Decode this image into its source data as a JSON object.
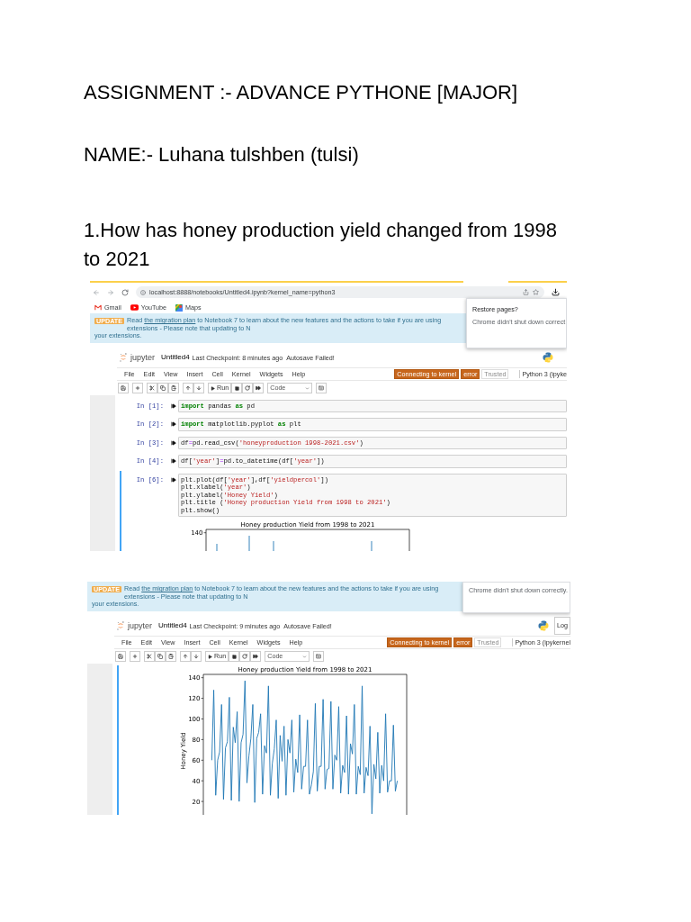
{
  "document": {
    "title": "ASSIGNMENT :- ADVANCE PYTHONE [MAJOR]",
    "student": "NAME:- Luhana tulshben (tulsi)",
    "question": "1.How has honey production yield changed from 1998 to 2021"
  },
  "screenshots": [
    {
      "browser": {
        "url": "localhost:8888/notebooks/Untitled4.ipynb?kernel_name=python3",
        "bookmarks": [
          {
            "kind": "gmail",
            "label": "Gmail"
          },
          {
            "kind": "youtube",
            "label": "YouTube"
          },
          {
            "kind": "maps",
            "label": "Maps"
          }
        ]
      },
      "popup": {
        "title": "Restore pages?",
        "message": "Chrome didn't shut down correct"
      },
      "banner": {
        "badge": "UPDATE",
        "before": "Read ",
        "link": "the migration plan",
        "after": " to Notebook 7 to learn about the new features and the actions to take if you are using extensions - Please note that updating to N",
        "second_line": "your extensions."
      },
      "header": {
        "logo": "jupyter",
        "notebook_name": "Untitled4",
        "checkpoint": "Last Checkpoint: 8 minutes ago",
        "autosave": "Autosave Failed!"
      },
      "menu": [
        "File",
        "Edit",
        "View",
        "Insert",
        "Cell",
        "Kernel",
        "Widgets",
        "Help"
      ],
      "indicators": [
        {
          "kind": "alert",
          "text": "Connecting to kernel"
        },
        {
          "kind": "alert",
          "text": "error"
        },
        {
          "kind": "plain",
          "text": "Trusted"
        }
      ],
      "kernel": "Python 3 (ipyke",
      "toolbar": {
        "run_label": "Run",
        "cell_type": "Code"
      },
      "cells": [
        {
          "prompt": "In [1]:",
          "selected": false,
          "lines": [
            [
              {
                "kind": "keyword",
                "text": "import"
              },
              {
                "kind": "plain",
                "text": " pandas "
              },
              {
                "kind": "keyword",
                "text": "as"
              },
              {
                "kind": "plain",
                "text": " pd"
              }
            ]
          ]
        },
        {
          "prompt": "In [2]:",
          "selected": false,
          "lines": [
            [
              {
                "kind": "keyword",
                "text": "import"
              },
              {
                "kind": "plain",
                "text": " matplotlib.pyplot "
              },
              {
                "kind": "keyword",
                "text": "as"
              },
              {
                "kind": "plain",
                "text": " plt"
              }
            ]
          ]
        },
        {
          "prompt": "In [3]:",
          "selected": false,
          "lines": [
            [
              {
                "kind": "plain",
                "text": "df"
              },
              {
                "kind": "operator",
                "text": "="
              },
              {
                "kind": "plain",
                "text": "pd.read_csv("
              },
              {
                "kind": "string",
                "text": "'honeyproduction 1998-2021.csv'"
              },
              {
                "kind": "plain",
                "text": ")"
              }
            ]
          ]
        },
        {
          "prompt": "In [4]:",
          "selected": false,
          "lines": [
            [
              {
                "kind": "plain",
                "text": "df["
              },
              {
                "kind": "string",
                "text": "'year'"
              },
              {
                "kind": "plain",
                "text": "]"
              },
              {
                "kind": "operator",
                "text": "="
              },
              {
                "kind": "plain",
                "text": "pd.to_datetime(df["
              },
              {
                "kind": "string",
                "text": "'year'"
              },
              {
                "kind": "plain",
                "text": "])"
              }
            ]
          ]
        },
        {
          "prompt": "In [6]:",
          "selected": true,
          "lines": [
            [
              {
                "kind": "plain",
                "text": "plt.plot(df["
              },
              {
                "kind": "string",
                "text": "'year'"
              },
              {
                "kind": "plain",
                "text": "],df["
              },
              {
                "kind": "string",
                "text": "'yieldpercol'"
              },
              {
                "kind": "plain",
                "text": "])"
              }
            ],
            [
              {
                "kind": "plain",
                "text": "plt.xlabel("
              },
              {
                "kind": "string",
                "text": "'year'"
              },
              {
                "kind": "plain",
                "text": ")"
              }
            ],
            [
              {
                "kind": "plain",
                "text": "plt.ylabel("
              },
              {
                "kind": "string",
                "text": "'Honey Yield'"
              },
              {
                "kind": "plain",
                "text": ")"
              }
            ],
            [
              {
                "kind": "plain",
                "text": "plt.title ("
              },
              {
                "kind": "string",
                "text": "'Honey production Yield from 1998 to 2021'"
              },
              {
                "kind": "plain",
                "text": ")"
              }
            ],
            [
              {
                "kind": "plain",
                "text": "plt.show()"
              }
            ]
          ],
          "output": {
            "kind": "picture",
            "title": "Honey production Yield from 1998 to 2021",
            "ytick_labels": [
              "140"
            ]
          }
        }
      ]
    },
    {
      "popup": {
        "message": "Chrome didn't shut down correctly."
      },
      "banner": {
        "badge": "UPDATE",
        "before": "Read ",
        "link": "the migration plan",
        "after": " to Notebook 7 to learn about the new features and the actions to take if you are using extensions - Please note that updating to N",
        "second_line": "your extensions."
      },
      "header": {
        "logo": "jupyter",
        "notebook_name": "Untitled4",
        "checkpoint": "Last Checkpoint: 9 minutes ago",
        "autosave": "Autosave Failed!",
        "logout": "Log"
      },
      "menu": [
        "File",
        "Edit",
        "View",
        "Insert",
        "Cell",
        "Kernel",
        "Widgets",
        "Help"
      ],
      "indicators": [
        {
          "kind": "alert",
          "text": "Connecting to kernel"
        },
        {
          "kind": "alert",
          "text": "error"
        },
        {
          "kind": "plain",
          "text": "Trusted"
        }
      ],
      "kernel": "Python 3 (ipykernel",
      "toolbar": {
        "run_label": "Run",
        "cell_type": "Code"
      },
      "cells": [
        {
          "selected": true,
          "output": {
            "kind": "chart",
            "chart_data": {
              "type": "line",
              "title": "Honey production Yield from 1998 to 2021",
              "ylabel": "Honey Yield",
              "ylim": [
                7,
                143.2
              ],
              "yticks": [
                20,
                40,
                60,
                80,
                100,
                120,
                140
              ],
              "categories": [
                null,
                null,
                null,
                null,
                null,
                null,
                null,
                null,
                null,
                null,
                null,
                null,
                null,
                null,
                null,
                null,
                null,
                null,
                null,
                null,
                null,
                null,
                null,
                null,
                null,
                null,
                null,
                null,
                null,
                null,
                null,
                null,
                null,
                null,
                null,
                null,
                null,
                null,
                null,
                null,
                null,
                null,
                null,
                null,
                null,
                null,
                null,
                null,
                null,
                null,
                null,
                null,
                null,
                null,
                null,
                null,
                null,
                null,
                null,
                null,
                null,
                null,
                null,
                null,
                null,
                null,
                null,
                null,
                null,
                null,
                null,
                null,
                null,
                null,
                null,
                null,
                null,
                null,
                null,
                null,
                null,
                null,
                null,
                null,
                null,
                null,
                null,
                null,
                null,
                null,
                null,
                null,
                null,
                null,
                null,
                null
              ],
              "values": [
                60,
                128,
                26,
                60,
                68,
                114,
                22,
                72,
                78,
                121,
                21,
                92,
                77,
                107,
                20,
                77,
                85,
                137,
                38,
                64,
                81,
                114,
                19,
                81,
                87,
                105,
                27,
                74,
                67,
                132,
                26,
                57,
                71,
                99,
                23,
                84,
                59,
                93,
                26,
                80,
                67,
                99,
                29,
                61,
                48,
                104,
                32,
                54,
                54,
                99,
                27,
                36,
                49,
                115,
                30,
                54,
                54,
                119,
                32,
                51,
                52,
                117,
                32,
                65,
                60,
                112,
                28,
                55,
                48,
                103,
                27,
                76,
                66,
                114,
                27,
                54,
                46,
                132,
                28,
                53,
                45,
                93,
                8,
                56,
                42,
                87,
                28,
                55,
                40,
                105,
                29,
                40,
                40,
                94,
                30,
                40
              ]
            }
          }
        }
      ]
    }
  ]
}
